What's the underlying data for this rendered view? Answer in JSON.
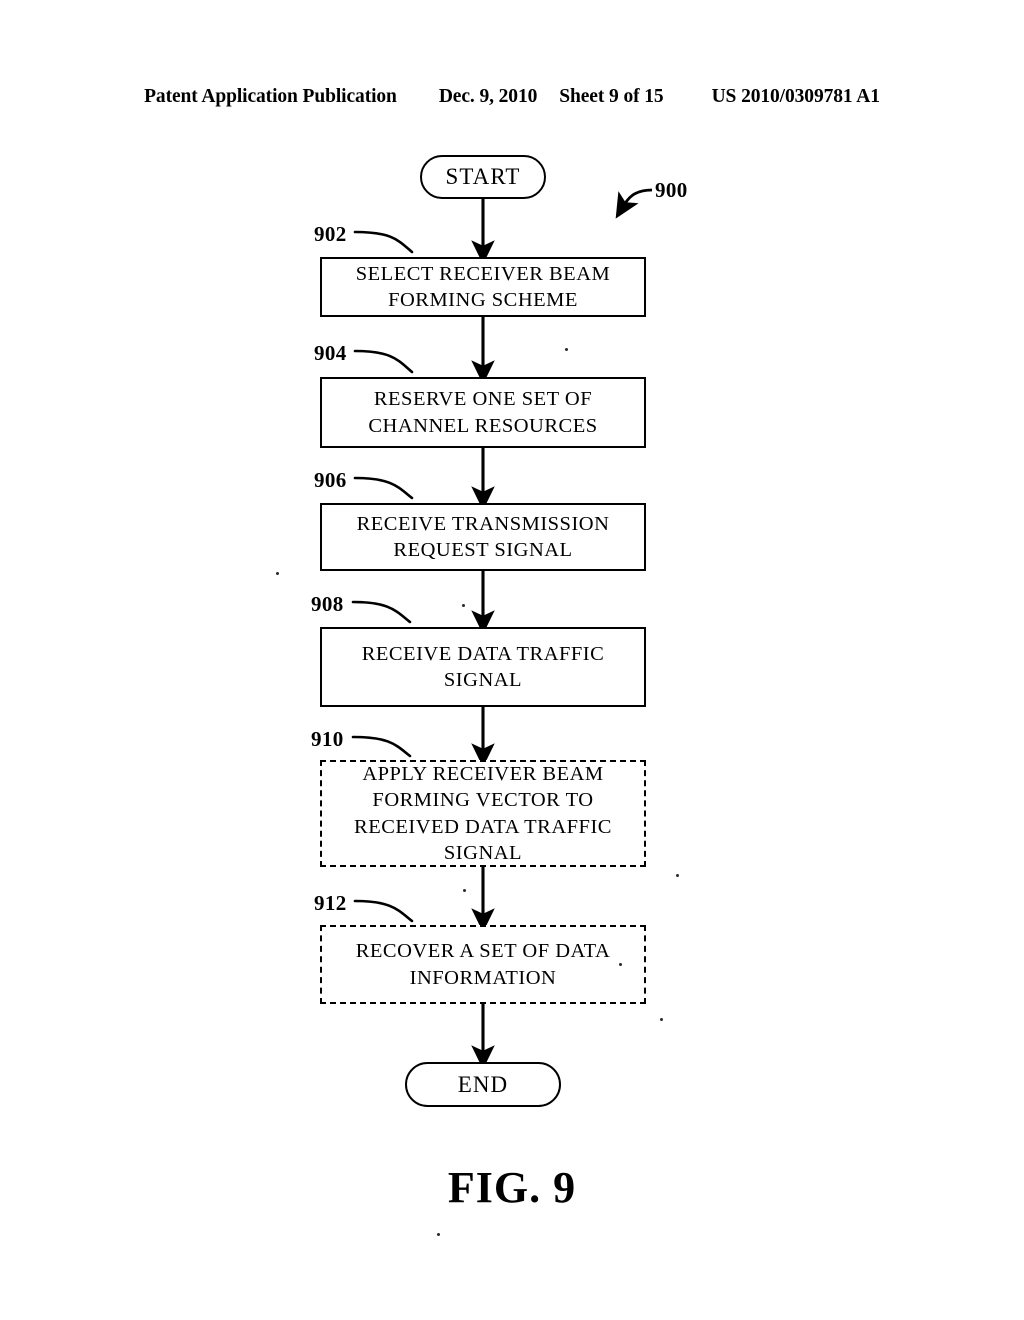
{
  "header": {
    "publication": "Patent Application Publication",
    "date": "Dec. 9, 2010",
    "sheet": "Sheet 9 of 15",
    "patent_number": "US 2010/0309781 A1"
  },
  "figure": {
    "caption": "FIG. 9",
    "diagram_reference": "900"
  },
  "flowchart": {
    "start_label": "START",
    "end_label": "END",
    "steps": [
      {
        "ref": "902",
        "text": "SELECT RECEIVER BEAM\nFORMING SCHEME",
        "border": "solid"
      },
      {
        "ref": "904",
        "text": "RESERVE ONE SET OF\nCHANNEL RESOURCES",
        "border": "solid"
      },
      {
        "ref": "906",
        "text": "RECEIVE TRANSMISSION\nREQUEST SIGNAL",
        "border": "solid"
      },
      {
        "ref": "908",
        "text": "RECEIVE DATA TRAFFIC\nSIGNAL",
        "border": "solid"
      },
      {
        "ref": "910",
        "text": "APPLY RECEIVER BEAM\nFORMING VECTOR TO\nRECEIVED DATA TRAFFIC\nSIGNAL",
        "border": "dashed"
      },
      {
        "ref": "912",
        "text": "RECOVER A SET OF DATA\nINFORMATION",
        "border": "dashed"
      }
    ]
  },
  "colors": {
    "ink": "#000000",
    "paper": "#ffffff"
  }
}
